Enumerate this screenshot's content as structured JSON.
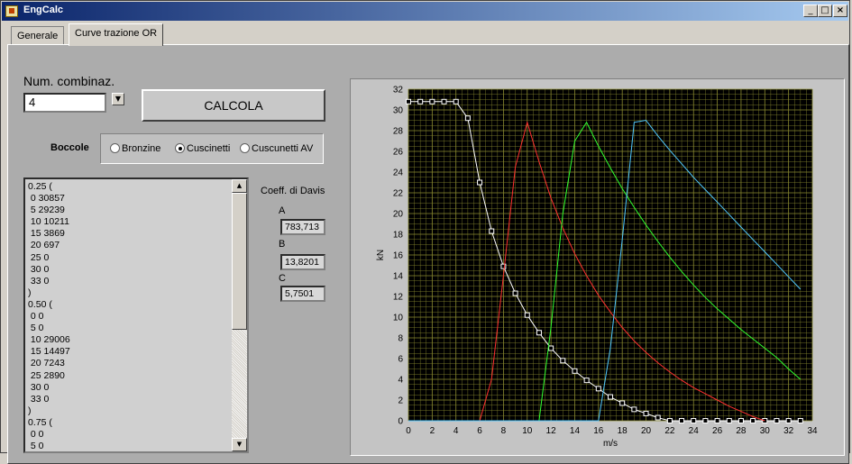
{
  "window": {
    "title": "EngCalc",
    "min_label": "_",
    "max_label": "□",
    "close_label": "×"
  },
  "tabs": [
    {
      "label": "Generale",
      "active": false
    },
    {
      "label": "Curve trazione OR",
      "active": true
    }
  ],
  "controls": {
    "num_label": "Num. combinaz.",
    "num_value": "4",
    "calc_button": "CALCOLA",
    "boccole_label": "Boccole",
    "radios": [
      {
        "label": "Bronzine",
        "selected": false
      },
      {
        "label": "Cuscinetti",
        "selected": true
      },
      {
        "label": "Cuscunetti AV",
        "selected": false
      }
    ]
  },
  "results_list": "0.25 (\n 0 30857\n 5 29239\n 10 10211\n 15 3869\n 20 697\n 25 0\n 30 0\n 33 0\n)\n0.50 (\n 0 0\n 5 0\n 10 29006\n 15 14497\n 20 7243\n 25 2890\n 30 0\n 33 0\n)\n0.75 (\n 0 0\n 5 0",
  "davis": {
    "title": "Coeff. di Davis",
    "labels": [
      "A",
      "B",
      "C"
    ],
    "values": [
      "783,713",
      "13,8201",
      "5,7501"
    ]
  },
  "chart_data": {
    "type": "line",
    "xlabel": "m/s",
    "ylabel": "kN",
    "xlim": [
      0,
      34
    ],
    "ylim": [
      0,
      32
    ],
    "x_ticks": [
      0,
      2,
      4,
      6,
      8,
      10,
      12,
      14,
      16,
      18,
      20,
      22,
      24,
      26,
      28,
      30,
      32,
      34
    ],
    "y_ticks": [
      0,
      2,
      4,
      6,
      8,
      10,
      12,
      14,
      16,
      18,
      20,
      22,
      24,
      26,
      28,
      30,
      32
    ],
    "grid": true,
    "background": "#000000",
    "grid_color": "#8a8a30",
    "series": [
      {
        "color": "#ffffff",
        "markers": true,
        "points": [
          [
            0,
            30.8
          ],
          [
            1,
            30.8
          ],
          [
            2,
            30.8
          ],
          [
            3,
            30.8
          ],
          [
            4,
            30.8
          ],
          [
            5,
            29.2
          ],
          [
            6,
            23
          ],
          [
            7,
            18.3
          ],
          [
            8,
            14.9
          ],
          [
            9,
            12.3
          ],
          [
            10,
            10.2
          ],
          [
            11,
            8.5
          ],
          [
            12,
            7.0
          ],
          [
            13,
            5.8
          ],
          [
            14,
            4.8
          ],
          [
            15,
            3.9
          ],
          [
            16,
            3.1
          ],
          [
            17,
            2.3
          ],
          [
            18,
            1.7
          ],
          [
            19,
            1.1
          ],
          [
            20,
            0.7
          ],
          [
            21,
            0.3
          ],
          [
            22,
            0
          ],
          [
            23,
            0
          ],
          [
            24,
            0
          ],
          [
            25,
            0
          ],
          [
            26,
            0
          ],
          [
            27,
            0
          ],
          [
            28,
            0
          ],
          [
            29,
            0
          ],
          [
            30,
            0
          ],
          [
            31,
            0
          ],
          [
            32,
            0
          ],
          [
            33,
            0
          ]
        ]
      },
      {
        "color": "#ff3030",
        "markers": false,
        "points": [
          [
            0,
            0
          ],
          [
            6,
            0
          ],
          [
            7,
            4
          ],
          [
            8,
            14
          ],
          [
            9,
            24.5
          ],
          [
            10,
            28.8
          ],
          [
            11,
            25
          ],
          [
            12,
            21.5
          ],
          [
            13,
            18.6
          ],
          [
            14,
            16.1
          ],
          [
            15,
            14
          ],
          [
            16,
            12.1
          ],
          [
            17,
            10.5
          ],
          [
            18,
            9.0
          ],
          [
            19,
            7.7
          ],
          [
            20,
            6.6
          ],
          [
            21,
            5.6
          ],
          [
            22,
            4.7
          ],
          [
            23,
            3.9
          ],
          [
            24,
            3.2
          ],
          [
            25,
            2.6
          ],
          [
            26,
            2.0
          ],
          [
            27,
            1.4
          ],
          [
            28,
            0.9
          ],
          [
            29,
            0.4
          ],
          [
            30,
            0
          ]
        ]
      },
      {
        "color": "#30ff30",
        "markers": false,
        "points": [
          [
            0,
            0
          ],
          [
            11,
            0
          ],
          [
            12,
            9
          ],
          [
            13,
            20
          ],
          [
            14,
            27
          ],
          [
            15,
            28.8
          ],
          [
            16,
            26.5
          ],
          [
            17,
            24.4
          ],
          [
            18,
            22.4
          ],
          [
            19,
            20.6
          ],
          [
            20,
            18.9
          ],
          [
            21,
            17.3
          ],
          [
            22,
            15.8
          ],
          [
            23,
            14.4
          ],
          [
            24,
            13.1
          ],
          [
            25,
            11.9
          ],
          [
            26,
            10.8
          ],
          [
            27,
            9.8
          ],
          [
            28,
            8.8
          ],
          [
            29,
            7.9
          ],
          [
            30,
            7.0
          ],
          [
            31,
            6.1
          ],
          [
            32,
            5.0
          ],
          [
            33,
            4.0
          ]
        ]
      },
      {
        "color": "#50c8ff",
        "markers": false,
        "points": [
          [
            0,
            0
          ],
          [
            16,
            0
          ],
          [
            17,
            7
          ],
          [
            18,
            17.5
          ],
          [
            19,
            28.8
          ],
          [
            20,
            29
          ],
          [
            21,
            27.5
          ],
          [
            22,
            26.1
          ],
          [
            23,
            24.8
          ],
          [
            24,
            23.5
          ],
          [
            25,
            22.3
          ],
          [
            26,
            21.1
          ],
          [
            27,
            19.9
          ],
          [
            28,
            18.7
          ],
          [
            29,
            17.5
          ],
          [
            30,
            16.3
          ],
          [
            31,
            15.1
          ],
          [
            32,
            13.9
          ],
          [
            33,
            12.7
          ]
        ]
      }
    ]
  }
}
